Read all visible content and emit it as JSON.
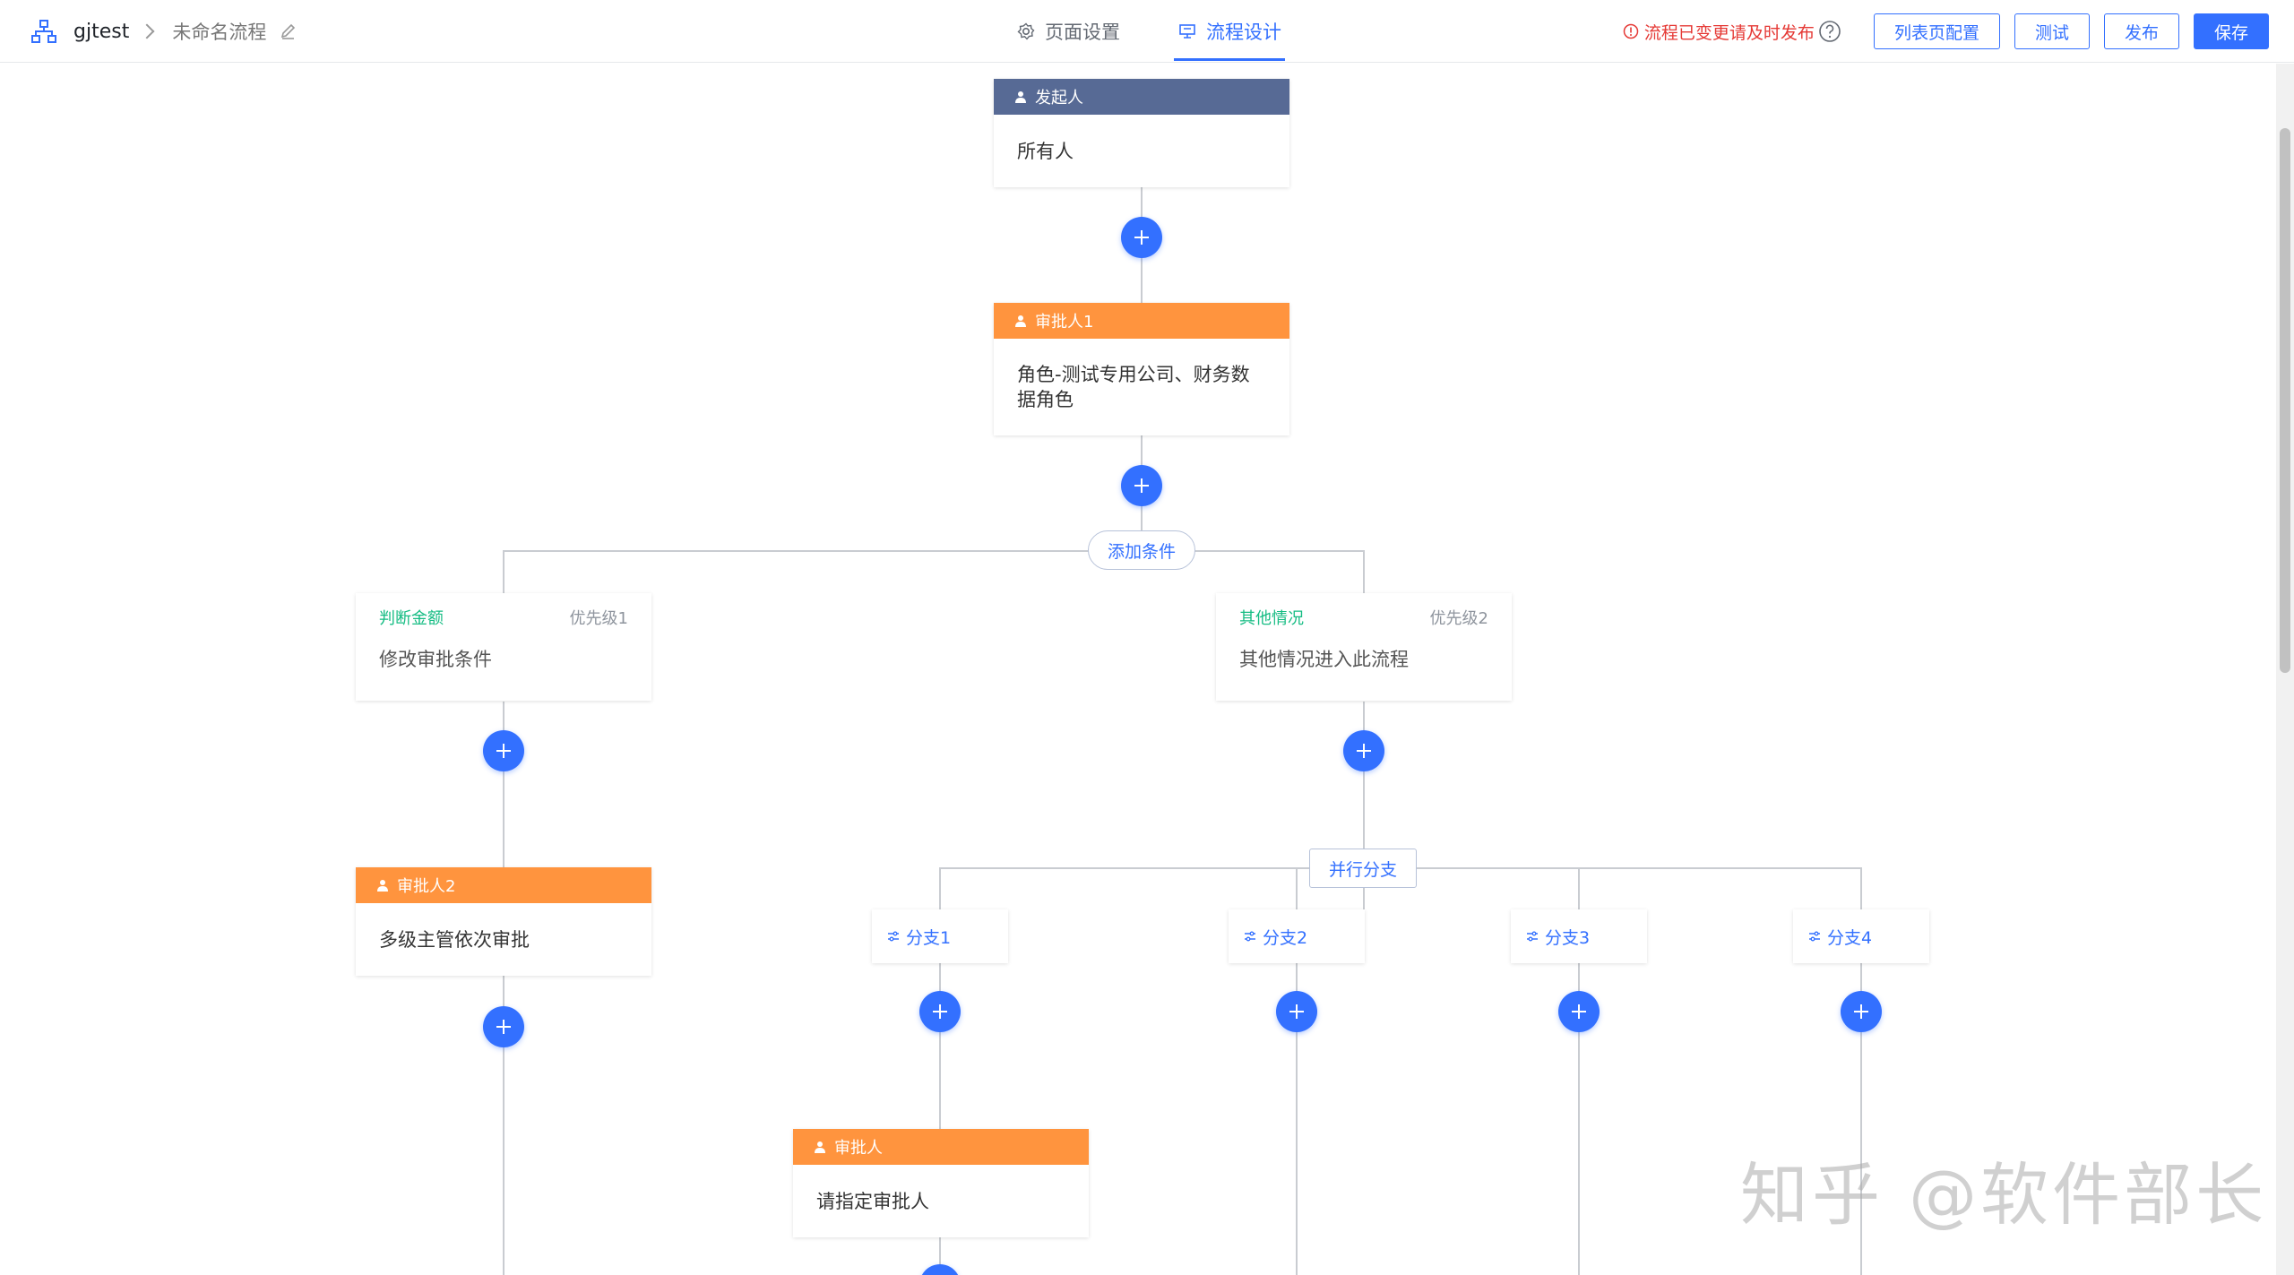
{
  "header": {
    "app_name": "gjtest",
    "flow_name": "未命名流程",
    "tabs": [
      {
        "label": "页面设置",
        "active": false,
        "icon": "gear-icon"
      },
      {
        "label": "流程设计",
        "active": true,
        "icon": "flow-icon"
      }
    ],
    "warning": "流程已变更请及时发布",
    "buttons": {
      "list_config": "列表页配置",
      "test": "测试",
      "publish": "发布",
      "save": "保存"
    }
  },
  "flow": {
    "initiator": {
      "title": "发起人",
      "content": "所有人"
    },
    "approver1": {
      "title": "审批人1",
      "content": "角色-测试专用公司、财务数据角色"
    },
    "add_condition": "添加条件",
    "conditions": [
      {
        "name": "判断金额",
        "priority": "优先级1",
        "desc": "修改审批条件"
      },
      {
        "name": "其他情况",
        "priority": "优先级2",
        "desc": "其他情况进入此流程"
      }
    ],
    "approver2": {
      "title": "审批人2",
      "content": "多级主管依次审批"
    },
    "parallel": "并行分支",
    "branches": [
      "分支1",
      "分支2",
      "分支3",
      "分支4"
    ],
    "approver3": {
      "title": "审批人",
      "content": "请指定审批人"
    }
  },
  "colors": {
    "primary": "#3370ff",
    "initiator_header": "#576a95",
    "approver_header": "#ff943e",
    "condition_name": "#15bc83",
    "warning": "#e53935"
  },
  "watermark": "知乎 @软件部长"
}
